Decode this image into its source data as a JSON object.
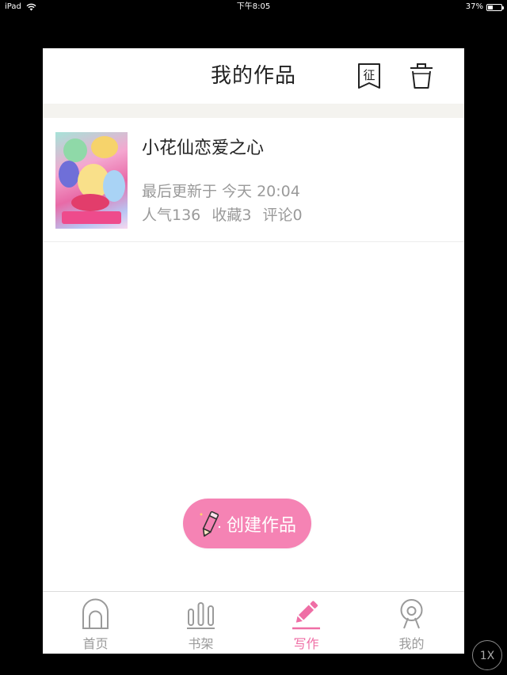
{
  "status_bar": {
    "device": "iPad",
    "time": "下午8:05",
    "battery": "37%",
    "battery_level": 0.37
  },
  "nav": {
    "title": "我的作品",
    "contest_icon_char": "征"
  },
  "works": [
    {
      "title": "小花仙恋爱之心",
      "updated": "最后更新于 今天 20:04",
      "popularity": "人气136",
      "favorites": "收藏3",
      "comments": "评论0"
    }
  ],
  "create_button": {
    "label": "创建作品"
  },
  "tabs": [
    {
      "label": "首页",
      "icon": "home-icon",
      "active": false
    },
    {
      "label": "书架",
      "icon": "bookshelf-icon",
      "active": false
    },
    {
      "label": "写作",
      "icon": "pen-icon",
      "active": true
    },
    {
      "label": "我的",
      "icon": "profile-icon",
      "active": false
    }
  ],
  "zoom_badge": "1X",
  "colors": {
    "accent": "#ef6ea5",
    "button": "#f583b4",
    "muted": "#9a9a9a"
  }
}
